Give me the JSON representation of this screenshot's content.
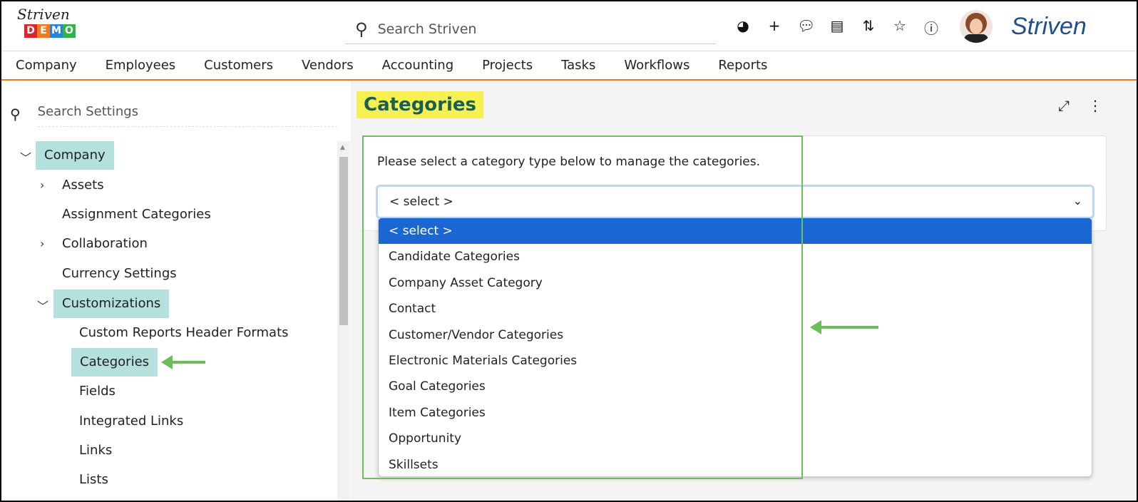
{
  "header": {
    "logo_script": "Striven",
    "logo_demo": [
      "D",
      "E",
      "M",
      "O"
    ],
    "logo_demo_colors": [
      "#d9262b",
      "#ef7a22",
      "#2a84d6",
      "#2fb34a"
    ],
    "search_placeholder": "Search Striven",
    "brand": "Striven",
    "icons": [
      "dashboard-icon",
      "plus-icon",
      "chat-icon",
      "news-icon",
      "sort-icon",
      "star-icon",
      "help-icon"
    ]
  },
  "nav": [
    "Company",
    "Employees",
    "Customers",
    "Vendors",
    "Accounting",
    "Projects",
    "Tasks",
    "Workflows",
    "Reports"
  ],
  "sidebar": {
    "search_placeholder": "Search Settings",
    "items": [
      "Company",
      "Assets",
      "Assignment Categories",
      "Collaboration",
      "Currency Settings",
      "Customizations",
      "Custom Reports Header Formats",
      "Categories",
      "Fields",
      "Integrated Links",
      "Links",
      "Lists"
    ]
  },
  "main": {
    "title": "Categories",
    "message": "Please select a category type below to manage the categories.",
    "select_value": "< select >",
    "options": [
      "< select >",
      "Candidate Categories",
      "Company Asset Category",
      "Contact",
      "Customer/Vendor Categories",
      "Electronic Materials Categories",
      "Goal Categories",
      "Item Categories",
      "Opportunity",
      "Skillsets"
    ]
  },
  "colors": {
    "accent": "#f07a1a",
    "highlight": "#b4e0dd",
    "title_bg": "#f7f052",
    "selected": "#1a66d2",
    "annotation": "#6bbf5a"
  }
}
